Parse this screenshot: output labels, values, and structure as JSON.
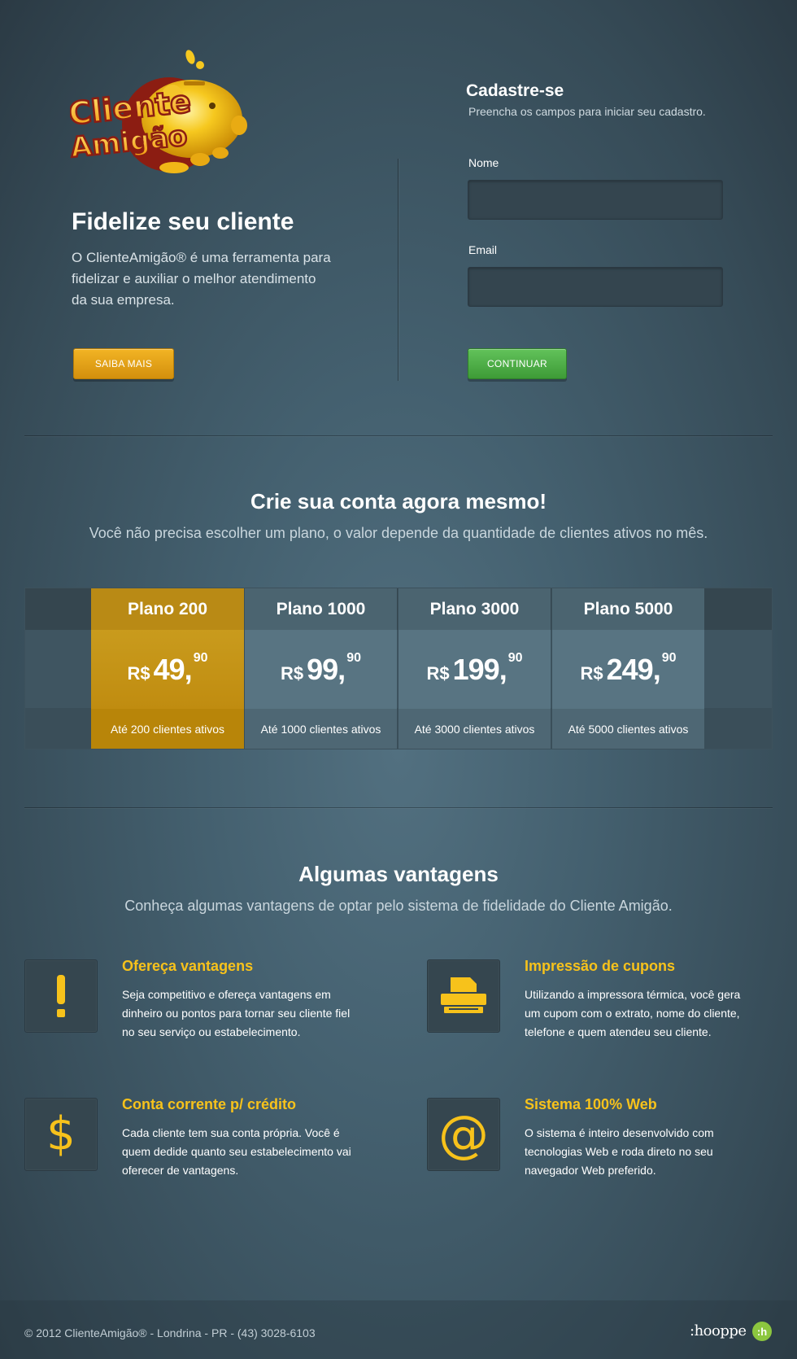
{
  "logo": {
    "line1": "Cliente",
    "line2": "Amigão"
  },
  "hero": {
    "title": "Fidelize seu cliente",
    "text": "O ClienteAmigão® é uma ferramenta para fidelizar e auxiliar o melhor atendimento da sua empresa.",
    "button": "SAIBA MAIS"
  },
  "signup": {
    "title": "Cadastre-se",
    "subtitle": "Preencha os campos para iniciar seu cadastro.",
    "name_label": "Nome",
    "name_value": "",
    "email_label": "Email",
    "email_value": "",
    "button": "CONTINUAR"
  },
  "plans_section": {
    "title": "Crie sua conta agora mesmo!",
    "subtitle": "Você não precisa escolher um plano, o valor depende da quantidade de clientes ativos no mês.",
    "plans": [
      {
        "name": "Plano 200",
        "currency": "R$",
        "price": "49,",
        "cents": "90",
        "desc": "Até 200 clientes ativos"
      },
      {
        "name": "Plano 1000",
        "currency": "R$",
        "price": "99,",
        "cents": "90",
        "desc": "Até 1000 clientes ativos"
      },
      {
        "name": "Plano 3000",
        "currency": "R$",
        "price": "199,",
        "cents": "90",
        "desc": "Até 3000 clientes ativos"
      },
      {
        "name": "Plano 5000",
        "currency": "R$",
        "price": "249,",
        "cents": "90",
        "desc": "Até 5000 clientes ativos"
      }
    ]
  },
  "advantages": {
    "title": "Algumas vantagens",
    "subtitle": "Conheça algumas vantagens de optar pelo sistema de fidelidade do Cliente Amigão.",
    "items": [
      {
        "icon": "exclamation-icon",
        "title": "Ofereça vantagens",
        "text": "Seja competitivo e ofereça vantagens em dinheiro ou pontos para tornar seu cliente fiel no seu  serviço ou estabelecimento."
      },
      {
        "icon": "printer-icon",
        "title": "Impressão de cupons",
        "text": "Utilizando a impressora térmica, você gera um  cupom com o extrato, nome do cliente, telefone e  quem atendeu seu cliente."
      },
      {
        "icon": "dollar-icon",
        "title": "Conta corrente p/ crédito",
        "text": "Cada cliente tem sua conta própria. Você é quem dedide quanto seu  estabelecimento vai oferecer de vantagens."
      },
      {
        "icon": "at-icon",
        "title": "Sistema 100% Web",
        "text": "O sistema é inteiro desenvolvido com tecnologias Web e roda direto no seu navegador Web preferido."
      }
    ]
  },
  "footer": {
    "copyright": "© 2012 ClienteAmigão® - Londrina - PR - (43) 3028-6103",
    "brand": ":hooppe",
    "badge": ":h"
  },
  "colors": {
    "accent": "#f7c21b",
    "gold_button": "#e0a318",
    "green_button": "#4fae47",
    "badge": "#8cc63f"
  }
}
